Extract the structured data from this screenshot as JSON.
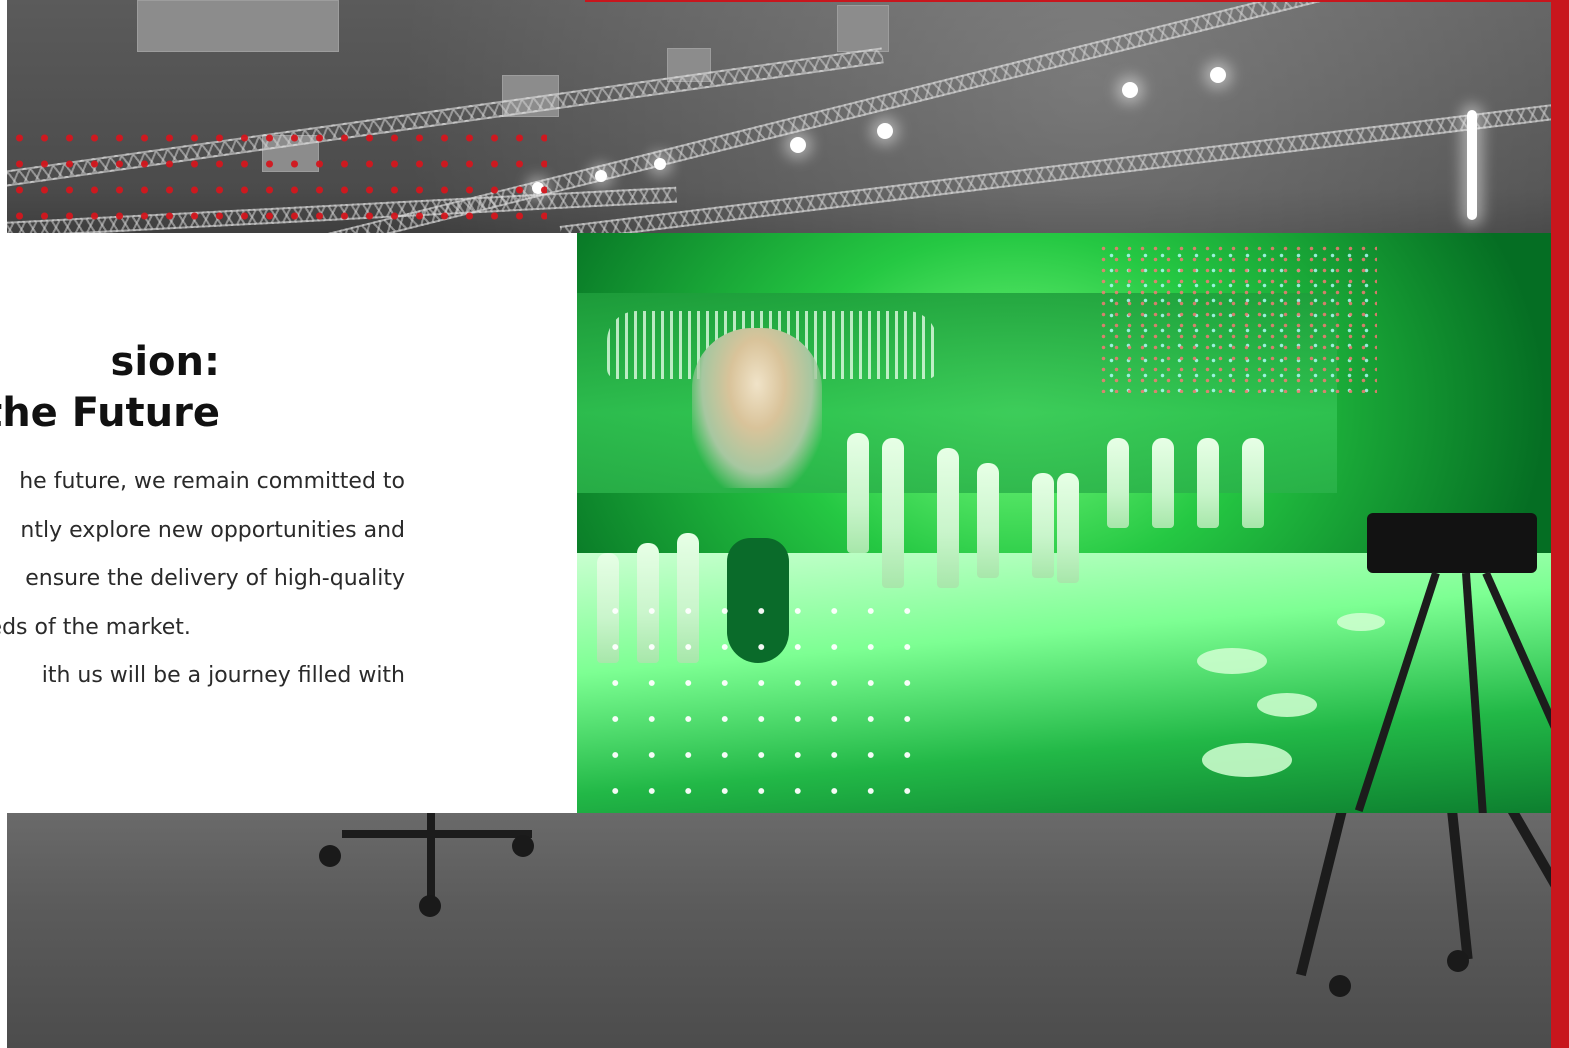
{
  "section": {
    "title_lines": [
      "Our Vision:",
      "Towards the Future"
    ],
    "visible_title_lines": [
      "sion:",
      "the Future"
    ],
    "body_lines": [
      "he future, we remain committed to",
      "ntly explore new opportunities and",
      "ensure the delivery of high-quality",
      "eeds of the market.",
      "ith us will be a journey filled with"
    ]
  },
  "colors": {
    "accent_red": "#c8161d",
    "text_dark": "#111111",
    "card_bg": "#ffffff",
    "photo_green": "#1fb343"
  },
  "images": {
    "background": "grayscale-event-hall-with-lighting-truss",
    "feature": "green-lit-national-day-stage-performance"
  }
}
